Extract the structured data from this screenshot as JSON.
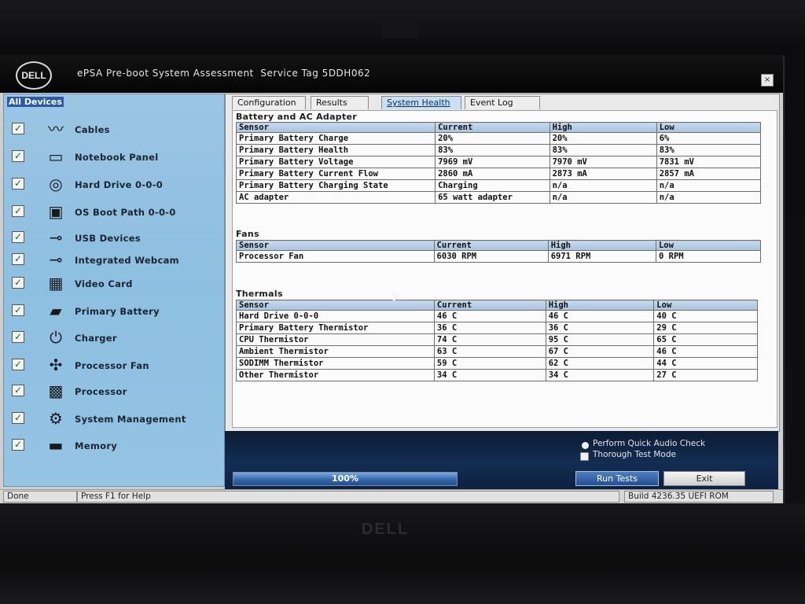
{
  "app": {
    "logo_text": "DELL",
    "title": "ePSA Pre-boot System Assessment  Service Tag 5DDH062",
    "close_label": "×"
  },
  "sidebar": {
    "header": "All Devices",
    "items": [
      {
        "label": "Cables",
        "checked": true,
        "icon": "cable-icon"
      },
      {
        "label": "Notebook Panel",
        "checked": true,
        "icon": "panel-icon"
      },
      {
        "label": "Hard Drive 0-0-0",
        "checked": true,
        "icon": "hard-drive-icon"
      },
      {
        "label": "OS Boot Path 0-0-0",
        "checked": true,
        "icon": "boot-path-icon"
      },
      {
        "label": "USB Devices",
        "checked": true,
        "icon": "usb-icon"
      },
      {
        "label": "Integrated Webcam",
        "checked": true,
        "icon": "usb-icon"
      },
      {
        "label": "Video Card",
        "checked": true,
        "icon": "video-card-icon"
      },
      {
        "label": "Primary Battery",
        "checked": true,
        "icon": "battery-icon"
      },
      {
        "label": "Charger",
        "checked": true,
        "icon": "charger-icon"
      },
      {
        "label": "Processor Fan",
        "checked": true,
        "icon": "fan-icon"
      },
      {
        "label": "Processor",
        "checked": true,
        "icon": "processor-icon"
      },
      {
        "label": "System Management",
        "checked": true,
        "icon": "system-management-icon"
      },
      {
        "label": "Memory",
        "checked": true,
        "icon": "memory-icon"
      }
    ]
  },
  "tabs": [
    {
      "label": "Configuration",
      "active": false
    },
    {
      "label": "Results",
      "active": false
    },
    {
      "label": "System Health",
      "active": true
    },
    {
      "label": "Event Log",
      "active": false
    }
  ],
  "battery": {
    "title": "Battery and AC Adapter",
    "headers": [
      "Sensor",
      "Current",
      "High",
      "Low"
    ],
    "rows": [
      [
        "Primary Battery Charge",
        "20%",
        "20%",
        "6%"
      ],
      [
        "Primary Battery Health",
        "83%",
        "83%",
        "83%"
      ],
      [
        "Primary Battery Voltage",
        "7969 mV",
        "7970 mV",
        "7831 mV"
      ],
      [
        "Primary Battery Current Flow",
        "2860 mA",
        "2873 mA",
        "2857 mA"
      ],
      [
        "Primary Battery Charging State",
        "Charging",
        "n/a",
        "n/a"
      ],
      [
        "AC adapter",
        "65 watt adapter",
        "n/a",
        "n/a"
      ]
    ]
  },
  "fans": {
    "title": "Fans",
    "headers": [
      "Sensor",
      "Current",
      "High",
      "Low"
    ],
    "rows": [
      [
        "Processor Fan",
        "6030 RPM",
        "6971 RPM",
        "0 RPM"
      ]
    ]
  },
  "thermals": {
    "title": "Thermals",
    "headers": [
      "Sensor",
      "Current",
      "High",
      "Low"
    ],
    "rows": [
      [
        "Hard Drive 0-0-0",
        "46 C",
        "46 C",
        "40 C"
      ],
      [
        "Primary Battery Thermistor",
        "36 C",
        "36 C",
        "29 C"
      ],
      [
        "CPU Thermistor",
        "74 C",
        "95 C",
        "65 C"
      ],
      [
        "Ambient Thermistor",
        "63 C",
        "67 C",
        "46 C"
      ],
      [
        "SODIMM Thermistor",
        "59 C",
        "62 C",
        "44 C"
      ],
      [
        "Other Thermistor",
        "34 C",
        "34 C",
        "27 C"
      ]
    ]
  },
  "options": {
    "quick_audio": "Perform Quick Audio Check",
    "thorough": "Thorough Test Mode"
  },
  "progress": {
    "value": 1.0,
    "label": "100%"
  },
  "buttons": {
    "run": "Run Tests",
    "exit": "Exit"
  },
  "status": {
    "left": "Done",
    "help": "Press F1 for Help",
    "build": "Build  4236.35 UEFI ROM"
  },
  "bezel": {
    "logo": "DELL"
  }
}
